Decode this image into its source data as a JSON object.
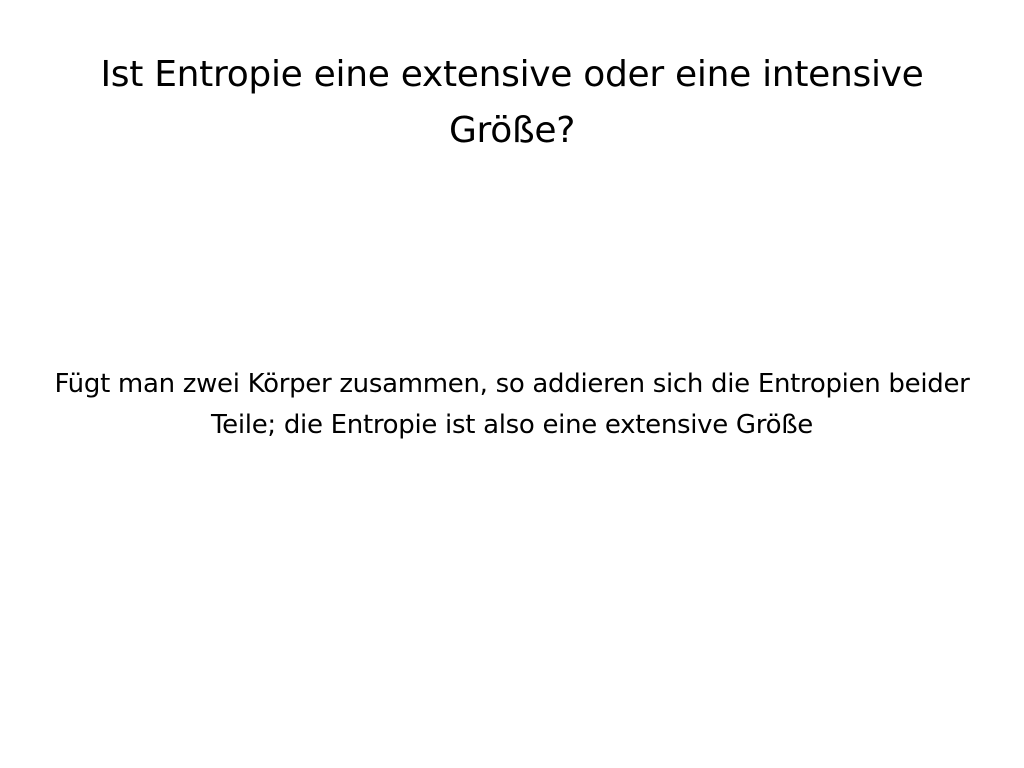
{
  "slide": {
    "title": "Ist Entropie eine extensive oder eine intensive Größe?",
    "body": "Fügt man zwei Körper zusammen, so addieren sich die Entropien beider Teile; die Entropie ist also eine extensive Größe"
  }
}
